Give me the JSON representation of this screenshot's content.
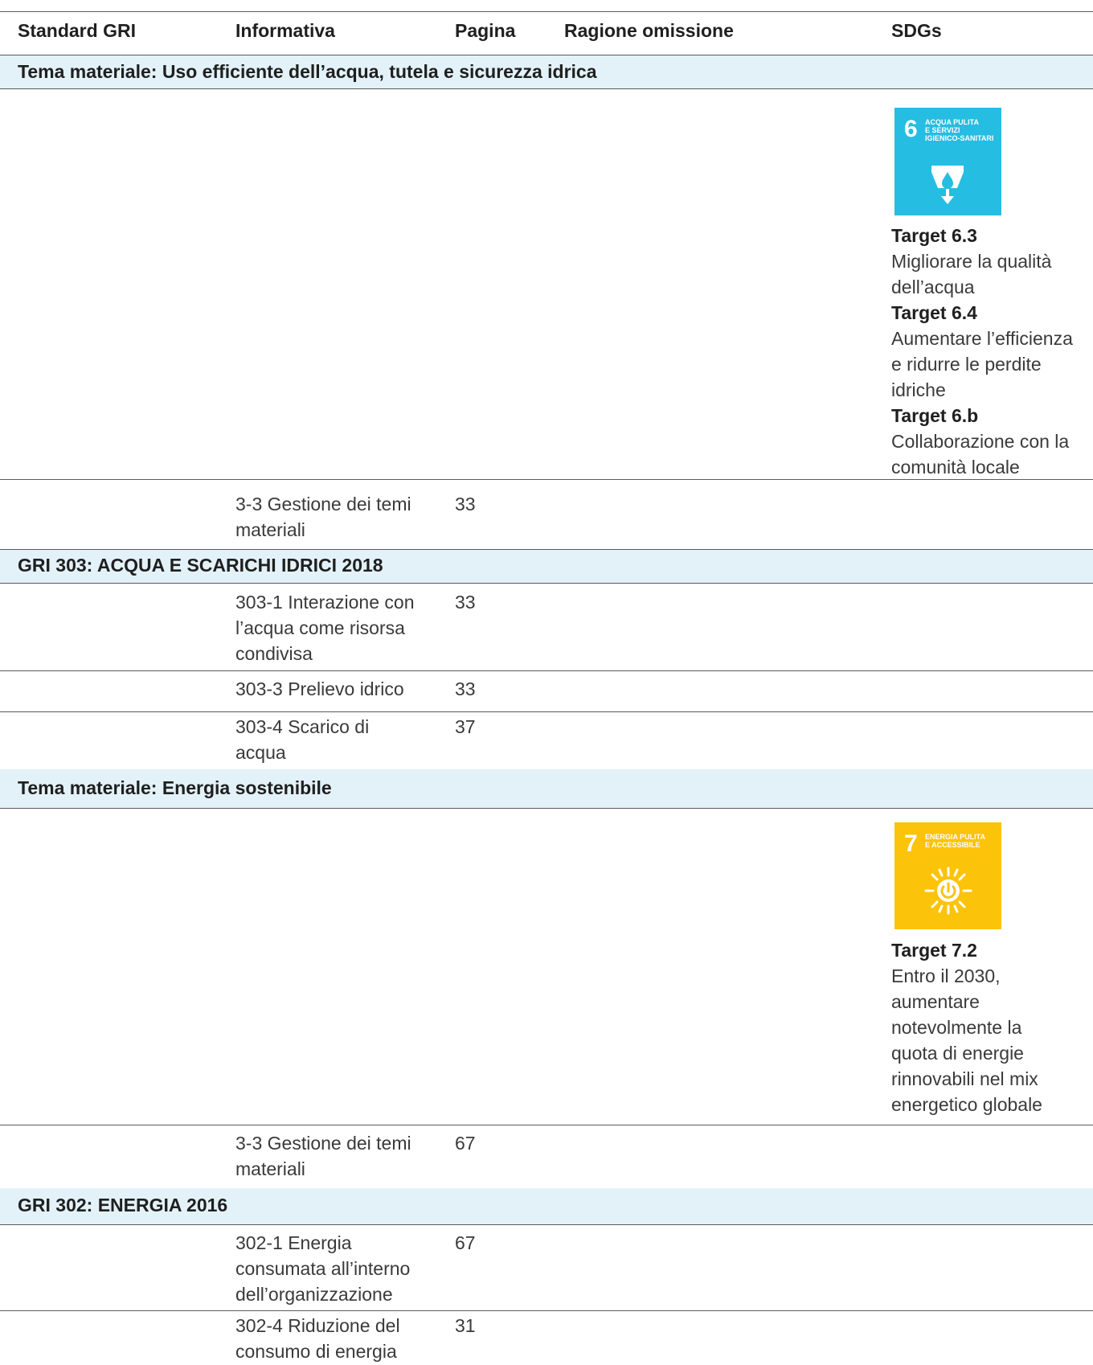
{
  "columns": {
    "standard": "Standard GRI",
    "informativa": "Informativa",
    "pagina": "Pagina",
    "omissione": "Ragione omissione",
    "sdgs": "SDGs"
  },
  "sections": {
    "water_topic": "Tema materiale: Uso efficiente dell’acqua, tutela e sicurezza idrica",
    "gri303": "GRI 303: ACQUA E SCARICHI IDRICI 2018",
    "energy_topic": "Tema materiale: Energia sostenibile",
    "gri302": "GRI 302: ENERGIA 2016"
  },
  "sdg6": {
    "number": "6",
    "title": "ACQUA PULITA\nE SERVIZI\nIGIENICO-SANITARI",
    "color": "#26bde2",
    "icon": "water-drop-icon",
    "targets": [
      {
        "label": "Target 6.3",
        "desc": [
          "Migliorare la qualità",
          "dell’acqua"
        ]
      },
      {
        "label": "Target 6.4",
        "desc": [
          "Aumentare l’efficienza",
          "e ridurre le perdite",
          "idriche"
        ]
      },
      {
        "label": "Target 6.b",
        "desc": [
          "Collaborazione con la",
          "comunità locale"
        ]
      }
    ]
  },
  "sdg7": {
    "number": "7",
    "title": "ENERGIA PULITA\nE ACCESSIBILE",
    "color": "#fcc30b",
    "icon": "sun-power-icon",
    "targets": [
      {
        "label": "Target 7.2",
        "desc": [
          "Entro il 2030,",
          "aumentare",
          "notevolmente la",
          "quota di energie",
          "rinnovabili nel mix",
          "energetico globale"
        ]
      }
    ]
  },
  "rows": {
    "water_33": {
      "informativa": [
        "3-3 Gestione dei temi",
        "materiali"
      ],
      "pagina": "33"
    },
    "r303_1": {
      "informativa": [
        "303-1 Interazione con",
        "l’acqua come risorsa",
        "condivisa"
      ],
      "pagina": "33"
    },
    "r303_3": {
      "informativa": [
        "303-3 Prelievo idrico"
      ],
      "pagina": "33"
    },
    "r303_4": {
      "informativa": [
        "303-4 Scarico di",
        "acqua"
      ],
      "pagina": "37"
    },
    "energy_33": {
      "informativa": [
        "3-3 Gestione dei temi",
        "materiali"
      ],
      "pagina": "67"
    },
    "r302_1": {
      "informativa": [
        "302-1 Energia",
        "consumata all’interno",
        "dell’organizzazione"
      ],
      "pagina": "67"
    },
    "r302_4": {
      "informativa": [
        "302-4 Riduzione del",
        "consumo di energia"
      ],
      "pagina": "31"
    }
  }
}
